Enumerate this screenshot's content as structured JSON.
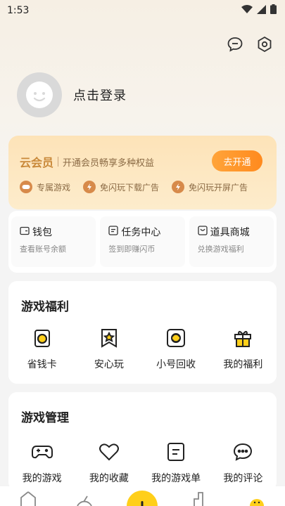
{
  "status_bar": {
    "time": "1:53"
  },
  "profile": {
    "login_label": "点击登录"
  },
  "vip": {
    "title": "云会员",
    "description": "开通会员畅享多种权益",
    "button_label": "去开通",
    "perks": [
      {
        "label": "专属游戏",
        "icon": "gamepad-icon"
      },
      {
        "label": "免闪玩下载广告",
        "icon": "no-ads-icon"
      },
      {
        "label": "免闪玩开屏广告",
        "icon": "no-ads-icon"
      }
    ]
  },
  "wallet": [
    {
      "title": "钱包",
      "sub": "查看账号余额",
      "icon": "wallet-icon"
    },
    {
      "title": "任务中心",
      "sub": "签到即赚闪币",
      "icon": "task-icon"
    },
    {
      "title": "道具商城",
      "sub": "兑换游戏福利",
      "icon": "shop-icon"
    }
  ],
  "game_benefits": {
    "title": "游戏福利",
    "items": [
      {
        "label": "省钱卡",
        "icon": "coin-card-icon"
      },
      {
        "label": "安心玩",
        "icon": "star-bookmark-icon"
      },
      {
        "label": "小号回收",
        "icon": "recycle-icon"
      },
      {
        "label": "我的福利",
        "icon": "gift-icon"
      }
    ]
  },
  "game_management": {
    "title": "游戏管理",
    "items": [
      {
        "label": "我的游戏",
        "icon": "gamepad-icon"
      },
      {
        "label": "我的收藏",
        "icon": "heart-icon"
      },
      {
        "label": "我的游戏单",
        "icon": "list-icon"
      },
      {
        "label": "我的评论",
        "icon": "comment-icon"
      }
    ]
  },
  "colors": {
    "accent": "#ffcf1a",
    "vip_button": "#ff8a1e",
    "vip_text": "#c9893a"
  }
}
